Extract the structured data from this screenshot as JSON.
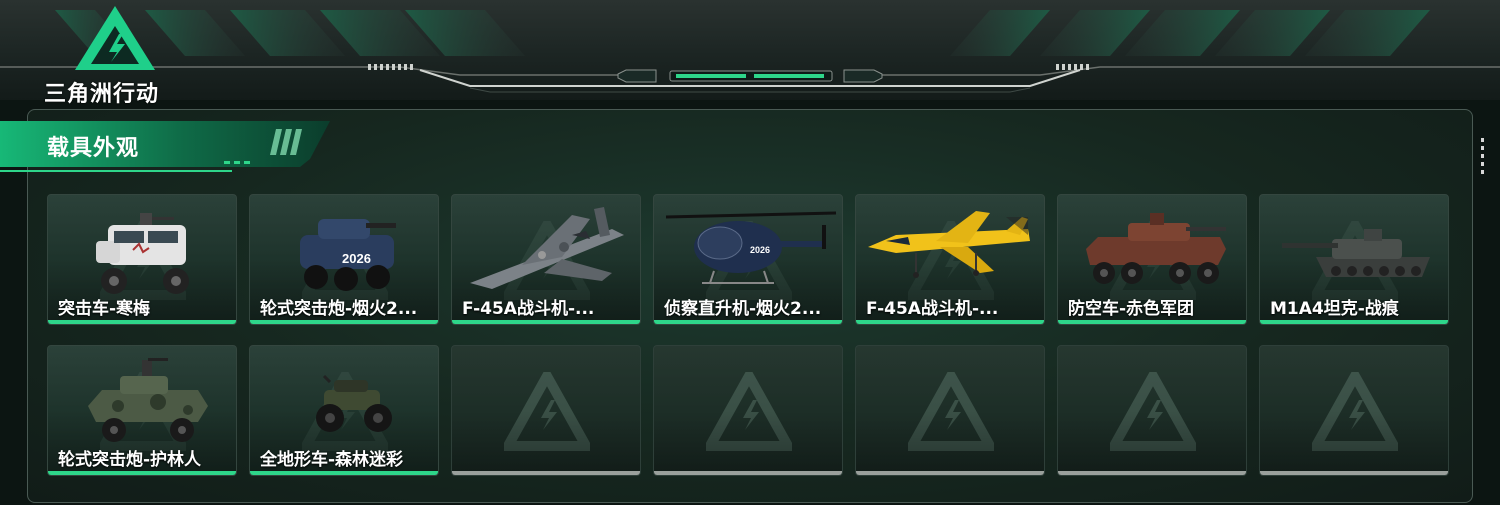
{
  "game": {
    "logo_text": "三角洲行动"
  },
  "section": {
    "title": "载具外观"
  },
  "colors": {
    "accent": "#2ed68a",
    "empty_bar": "#9aa09c",
    "panel_bg": "#16271f"
  },
  "rows": [
    [
      {
        "label": "突击车-寒梅",
        "icon": "assault-vehicle-white-camo",
        "empty": false
      },
      {
        "label": "轮式突击炮-烟火2...",
        "icon": "wheeled-assault-gun-blue",
        "empty": false
      },
      {
        "label": "F-45A战斗机-...",
        "icon": "fighter-jet-gray-camo",
        "empty": false
      },
      {
        "label": "侦察直升机-烟火2...",
        "icon": "scout-helicopter-blue",
        "empty": false
      },
      {
        "label": "F-45A战斗机-...",
        "icon": "fighter-jet-yellow",
        "empty": false
      },
      {
        "label": "防空车-赤色军团",
        "icon": "anti-air-vehicle-red",
        "empty": false
      },
      {
        "label": "M1A4坦克-战痕",
        "icon": "tank-gray",
        "empty": false
      }
    ],
    [
      {
        "label": "轮式突击炮-护林人",
        "icon": "wheeled-assault-gun-green-camo",
        "empty": false
      },
      {
        "label": "全地形车-森林迷彩",
        "icon": "atv-forest-camo",
        "empty": false
      },
      {
        "label": "",
        "icon": "empty-slot-emblem",
        "empty": true
      },
      {
        "label": "",
        "icon": "empty-slot-emblem",
        "empty": true
      },
      {
        "label": "",
        "icon": "empty-slot-emblem",
        "empty": true
      },
      {
        "label": "",
        "icon": "empty-slot-emblem",
        "empty": true
      },
      {
        "label": "",
        "icon": "empty-slot-emblem",
        "empty": true
      }
    ]
  ]
}
